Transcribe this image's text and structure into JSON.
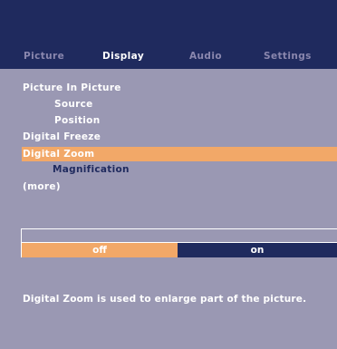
{
  "tabs": [
    {
      "label": "Picture",
      "active": false
    },
    {
      "label": "Display",
      "active": true
    },
    {
      "label": "Audio",
      "active": false
    },
    {
      "label": "Settings",
      "active": false
    }
  ],
  "menu": {
    "items": [
      {
        "label": "Picture In Picture",
        "level": 0
      },
      {
        "label": "Source",
        "level": 1
      },
      {
        "label": "Position",
        "level": 1
      },
      {
        "label": "Digital Freeze",
        "level": 0
      },
      {
        "label": "Digital Zoom",
        "level": 0,
        "selected": true
      },
      {
        "label": "Magnification",
        "level": 1
      },
      {
        "label": "(more)",
        "level": 0
      }
    ]
  },
  "control": {
    "options": [
      {
        "label": "off",
        "selected": true
      },
      {
        "label": "on",
        "selected": false
      }
    ]
  },
  "help": {
    "text": "Digital Zoom is used to enlarge part of the picture."
  },
  "colors": {
    "background": "#9a98b3",
    "header": "#1f2a5e",
    "highlight": "#f2a868",
    "inactive_tab": "#8a87ae",
    "text": "#ffffff"
  }
}
